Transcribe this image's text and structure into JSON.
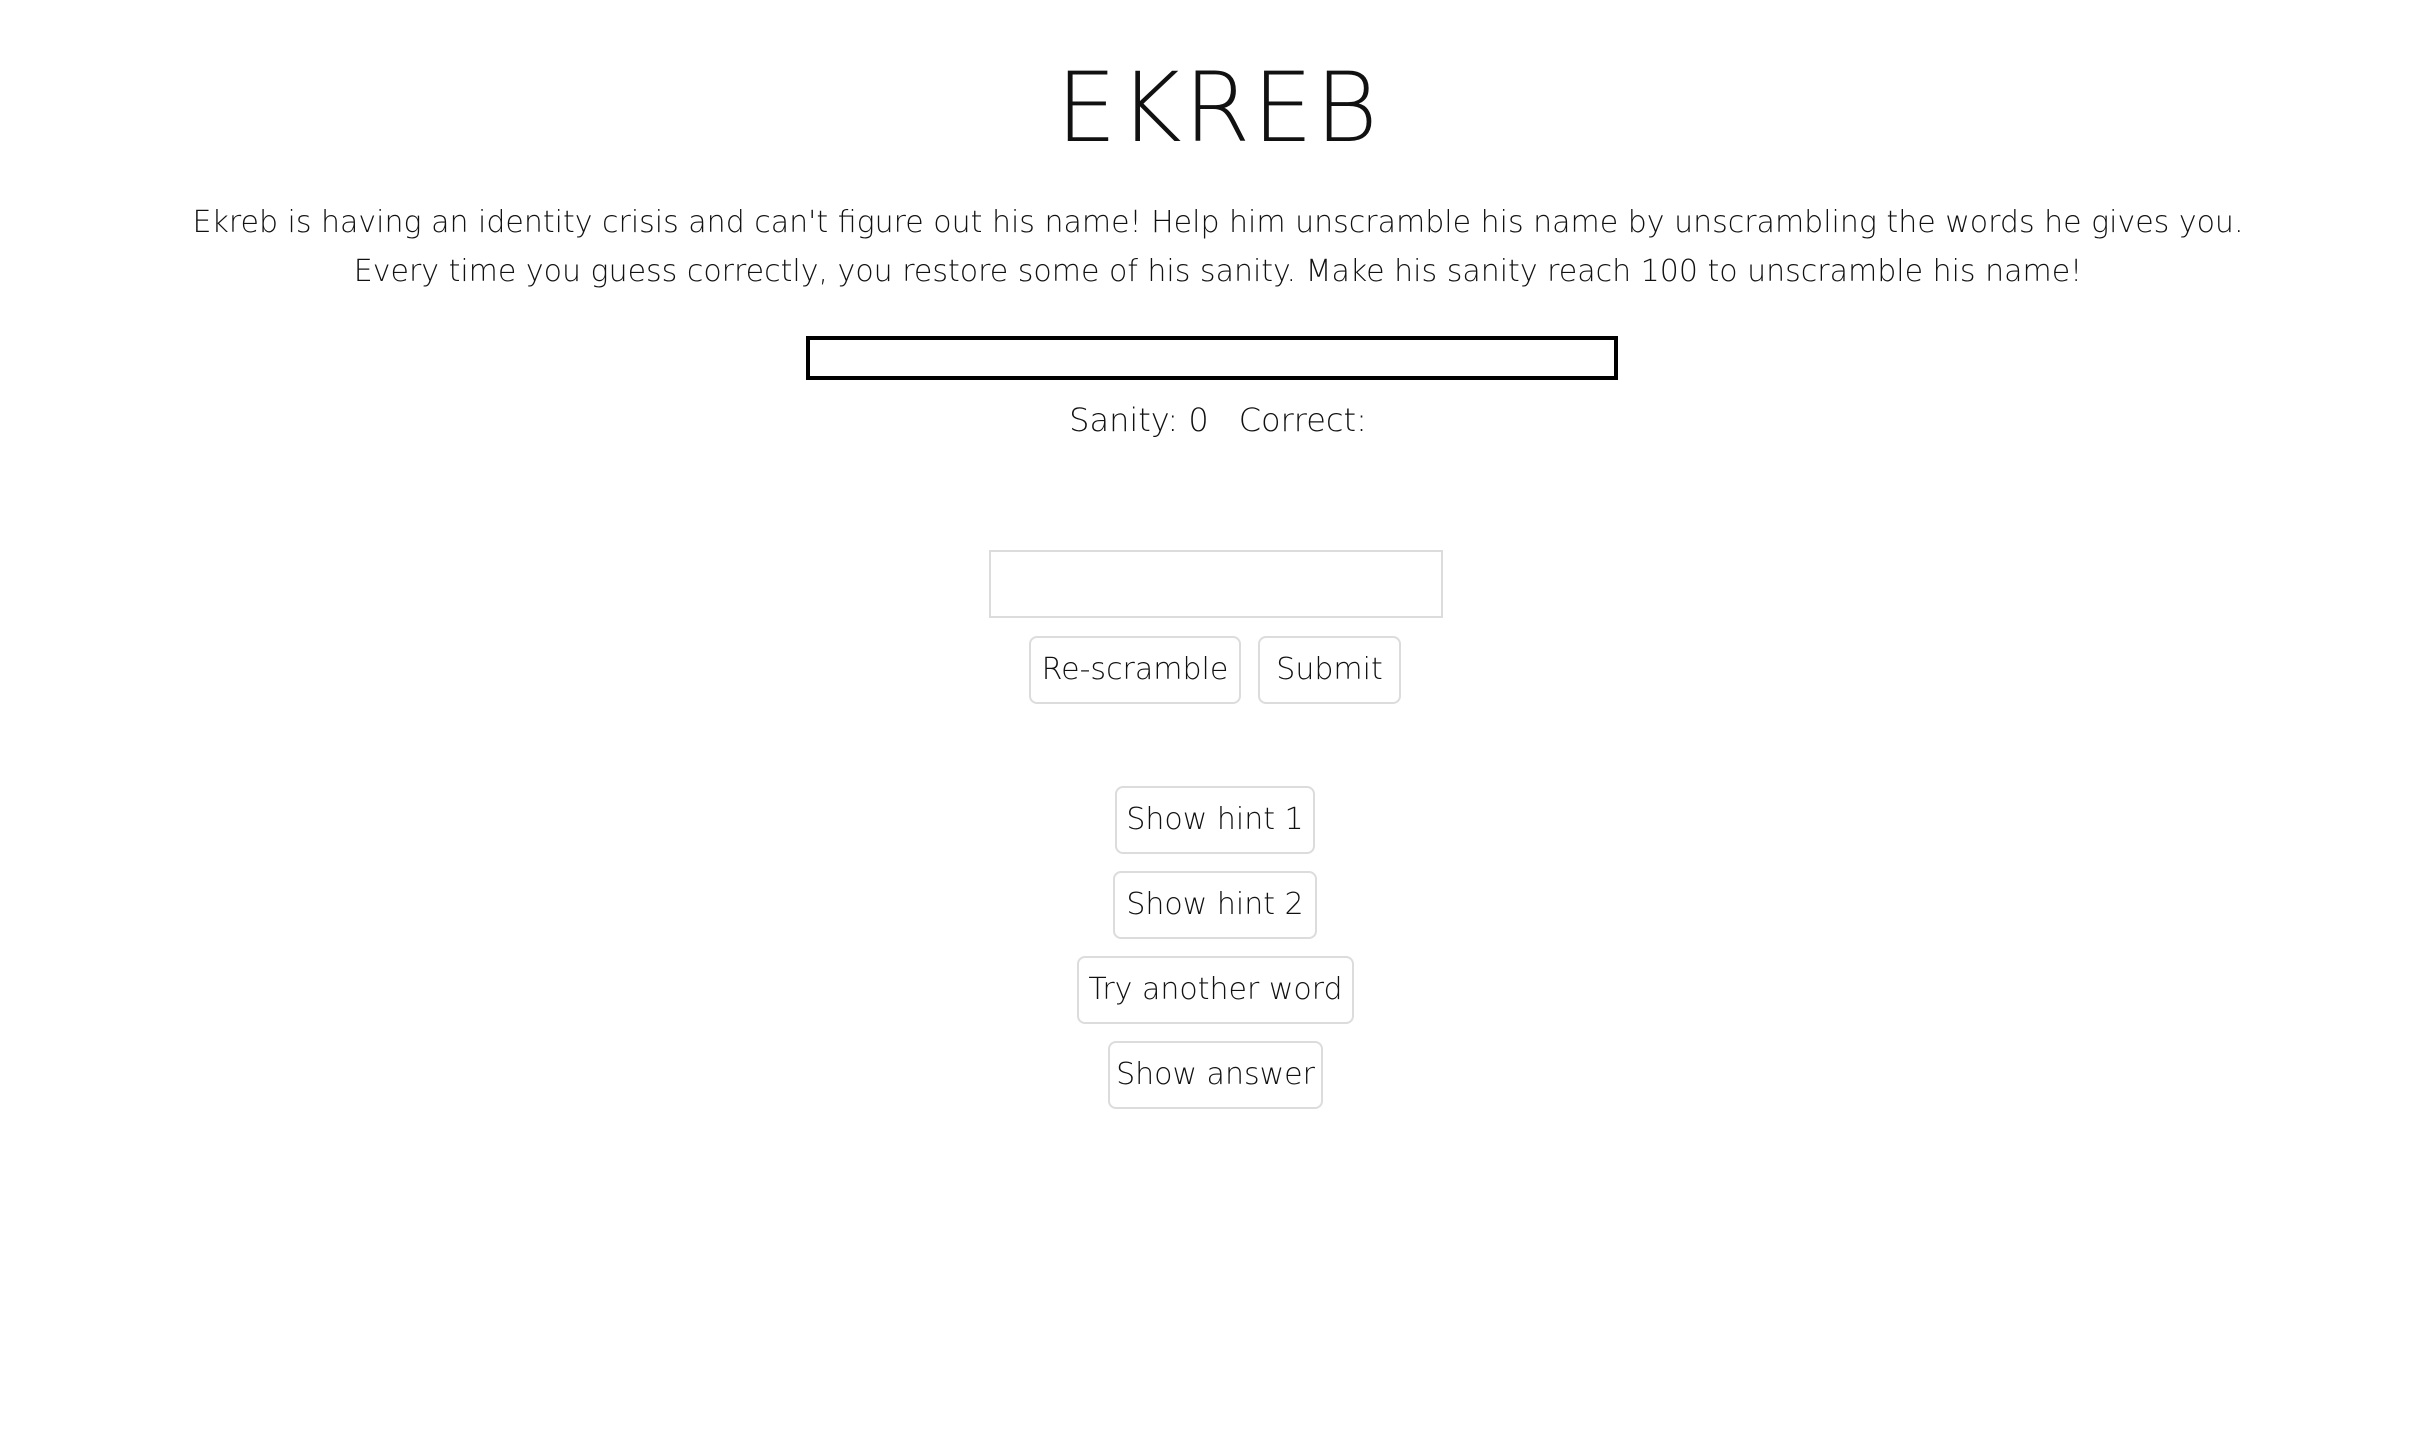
{
  "title": "EKREB",
  "description": {
    "line1": "Ekreb is having an identity crisis and can't figure out his name! Help him unscramble his name by unscrambling the words he gives you.",
    "line2": "Every time you guess correctly, you restore some of his sanity. Make his sanity reach 100 to unscramble his name!"
  },
  "progress": {
    "sanity_fraction": 0
  },
  "stats": {
    "sanity_text": "Sanity: 0",
    "correct_text": "Correct:"
  },
  "guess_input": {
    "value": "",
    "placeholder": ""
  },
  "buttons": {
    "rescramble": "Re-scramble",
    "submit": "Submit",
    "hint1": "Show hint 1",
    "hint2": "Show hint 2",
    "another_word": "Try another word",
    "show_answer": "Show answer"
  },
  "colors": {
    "bar_border": "#000000",
    "button_border": "#dcdcdc",
    "text": "#111111"
  }
}
